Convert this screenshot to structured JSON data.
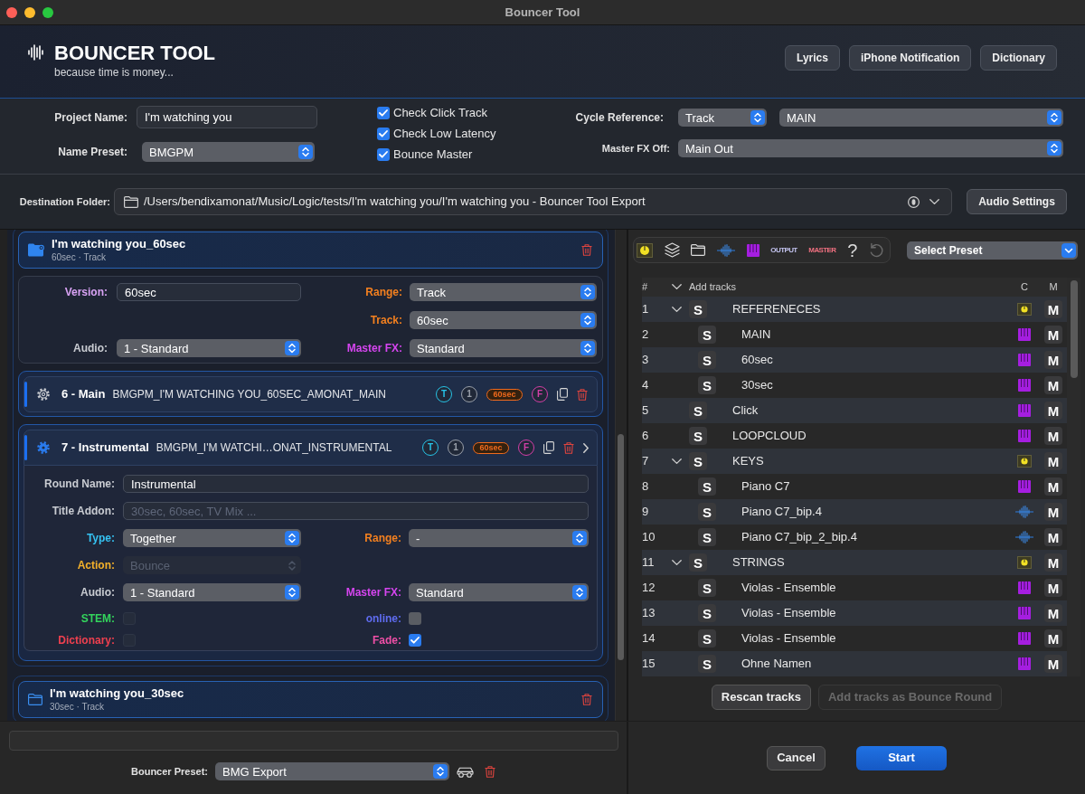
{
  "window": {
    "title": "Bouncer Tool"
  },
  "header": {
    "title": "BOUNCER TOOL",
    "tagline": "because time is money...",
    "buttons": [
      "Lyrics",
      "iPhone Notification",
      "Dictionary"
    ]
  },
  "project": {
    "name": {
      "label": "Project Name:",
      "value": "I'm watching you"
    },
    "name_preset": {
      "label": "Name Preset:",
      "value": "BMGPM"
    },
    "checks": [
      {
        "label": "Check Click Track",
        "checked": true
      },
      {
        "label": "Check Low Latency",
        "checked": true
      },
      {
        "label": "Bounce Master",
        "checked": true
      }
    ],
    "cycle_reference": {
      "label": "Cycle Reference:",
      "mode": "Track",
      "value": "MAIN"
    },
    "master_fx_off": {
      "label": "Master FX Off:",
      "value": "Main Out"
    }
  },
  "destination": {
    "label": "Destination Folder:",
    "path": "/Users/bendixamonat/Music/Logic/tests/I'm watching you/I'm watching you - Bouncer Tool Export",
    "button": "Audio Settings"
  },
  "versions": [
    {
      "title": "I'm watching you_60sec",
      "subtitle": "60sec · Track",
      "selected": true,
      "settings": [
        {
          "left": {
            "label": "Version:",
            "color": "#d9a3f5",
            "kind": "input",
            "value": "60sec"
          },
          "right": {
            "label": "Range:",
            "color": "#f4801f",
            "kind": "select",
            "value": "Track"
          }
        },
        {
          "right": {
            "label": "Track:",
            "color": "#f4801f",
            "kind": "select",
            "value": "60sec"
          }
        },
        {
          "left": {
            "label": "Audio:",
            "color": "#c9ccd2",
            "kind": "select",
            "value": "1 - Standard"
          },
          "right": {
            "label": "Master FX:",
            "color": "#d645f0",
            "kind": "select",
            "value": "Standard"
          }
        }
      ],
      "rounds": [
        {
          "title": "6 - Main",
          "filename": "BMGPM_I'M WATCHING YOU_60SEC_AMONAT_MAIN",
          "expanded": false,
          "badges": [
            {
              "text": "T",
              "kind": "circle",
              "color": "#27c4e8"
            },
            {
              "text": "1",
              "kind": "circle",
              "color": "#9aa0aa"
            },
            {
              "text": "60sec",
              "kind": "pill",
              "color": "#f06a1c"
            },
            {
              "text": "F",
              "kind": "circle",
              "color": "#d43fa8"
            }
          ]
        },
        {
          "title": "7 - Instrumental",
          "filename": "BMGPM_I'M WATCHI…ONAT_INSTRUMENTAL",
          "expanded": true,
          "badges": [
            {
              "text": "T",
              "kind": "circle",
              "color": "#27c4e8"
            },
            {
              "text": "1",
              "kind": "circle",
              "color": "#9aa0aa"
            },
            {
              "text": "60sec",
              "kind": "pill",
              "color": "#f06a1c"
            },
            {
              "text": "F",
              "kind": "circle",
              "color": "#d43fa8"
            }
          ],
          "form": [
            {
              "wide": {
                "label": "Round Name:",
                "color": "#c9ccd2",
                "kind": "input",
                "value": "Instrumental",
                "disabled": false
              }
            },
            {
              "wide": {
                "label": "Title Addon:",
                "color": "#c9ccd2",
                "kind": "input",
                "placeholder": "30sec, 60sec, TV Mix ...",
                "disabled": false
              }
            },
            {
              "left": {
                "label": "Type:",
                "color": "#35c2f2",
                "kind": "select",
                "value": "Together",
                "disabled": false
              },
              "right": {
                "label": "Range:",
                "color": "#f4801f",
                "kind": "select",
                "value": "-",
                "disabled": false
              }
            },
            {
              "left": {
                "label": "Action:",
                "color": "#f4b12a",
                "kind": "select",
                "value": "Bounce",
                "disabled": true
              }
            },
            {
              "left": {
                "label": "Audio:",
                "color": "#c9ccd2",
                "kind": "select",
                "value": "1 - Standard",
                "disabled": false
              },
              "right": {
                "label": "Master FX:",
                "color": "#d645f0",
                "kind": "select",
                "value": "Standard",
                "disabled": false
              }
            },
            {
              "left": {
                "label": "STEM:",
                "color": "#33d45c",
                "kind": "checkbox",
                "checked": false,
                "disabled": true
              },
              "right": {
                "label": "online:",
                "color": "#5f6cf0",
                "kind": "checkbox",
                "checked": false,
                "disabled": false
              }
            },
            {
              "left": {
                "label": "Dictionary:",
                "color": "#f0404f",
                "kind": "checkbox",
                "checked": false,
                "disabled": true
              },
              "right": {
                "label": "Fade:",
                "color": "#ef4fa6",
                "kind": "checkbox",
                "checked": true,
                "disabled": false
              }
            }
          ]
        }
      ]
    },
    {
      "title": "I'm watching you_30sec",
      "subtitle": "30sec · Track",
      "selected": false
    }
  ],
  "tracks": {
    "toolbar": {
      "output": "OUTPUT",
      "master": "MASTER",
      "help": "?"
    },
    "preset": {
      "value": "Select Preset"
    },
    "columns": [
      "#",
      "Add tracks",
      "C",
      "M"
    ],
    "rows": [
      {
        "number": "1",
        "name": "REFERENECES",
        "kind": "stack",
        "expanded": true,
        "solo": "S",
        "mute": "M",
        "children": [
          {
            "number": "2",
            "name": "MAIN",
            "kind": "instrument",
            "solo": "S",
            "mute": "M"
          },
          {
            "number": "3",
            "name": "60sec",
            "kind": "instrument",
            "solo": "S",
            "mute": "M"
          },
          {
            "number": "4",
            "name": "30sec",
            "kind": "instrument",
            "solo": "S",
            "mute": "M"
          }
        ]
      },
      {
        "number": "5",
        "name": "Click",
        "kind": "instrument",
        "solo": "S",
        "mute": "M"
      },
      {
        "number": "6",
        "name": "LOOPCLOUD",
        "kind": "instrument",
        "solo": "S",
        "mute": "M"
      },
      {
        "number": "7",
        "name": "KEYS",
        "kind": "stack",
        "expanded": true,
        "solo": "S",
        "mute": "M",
        "children": [
          {
            "number": "8",
            "name": "Piano C7",
            "kind": "instrument",
            "solo": "S",
            "mute": "M"
          },
          {
            "number": "9",
            "name": "Piano C7_bip.4",
            "kind": "audio",
            "solo": "S",
            "mute": "M"
          },
          {
            "number": "10",
            "name": "Piano C7_bip_2_bip.4",
            "kind": "audio",
            "solo": "S",
            "mute": "M"
          }
        ]
      },
      {
        "number": "11",
        "name": "STRINGS",
        "kind": "stack",
        "expanded": true,
        "solo": "S",
        "mute": "M",
        "children": [
          {
            "number": "12",
            "name": "Violas - Ensemble",
            "kind": "instrument",
            "solo": "S",
            "mute": "M"
          },
          {
            "number": "13",
            "name": "Violas - Ensemble",
            "kind": "instrument",
            "solo": "S",
            "mute": "M"
          },
          {
            "number": "14",
            "name": "Violas - Ensemble",
            "kind": "instrument",
            "solo": "S",
            "mute": "M"
          },
          {
            "number": "15",
            "name": "Ohne Namen",
            "kind": "instrument",
            "solo": "S",
            "mute": "M"
          }
        ]
      }
    ],
    "buttons": [
      {
        "label": "Rescan tracks",
        "disabled": false
      },
      {
        "label": "Add tracks as Bounce Round",
        "disabled": true
      }
    ]
  },
  "footer": {
    "preset": {
      "label": "Bouncer Preset:",
      "value": "BMG Export"
    },
    "buttons": [
      {
        "label": "Cancel",
        "primary": false
      },
      {
        "label": "Start",
        "primary": true
      }
    ]
  }
}
